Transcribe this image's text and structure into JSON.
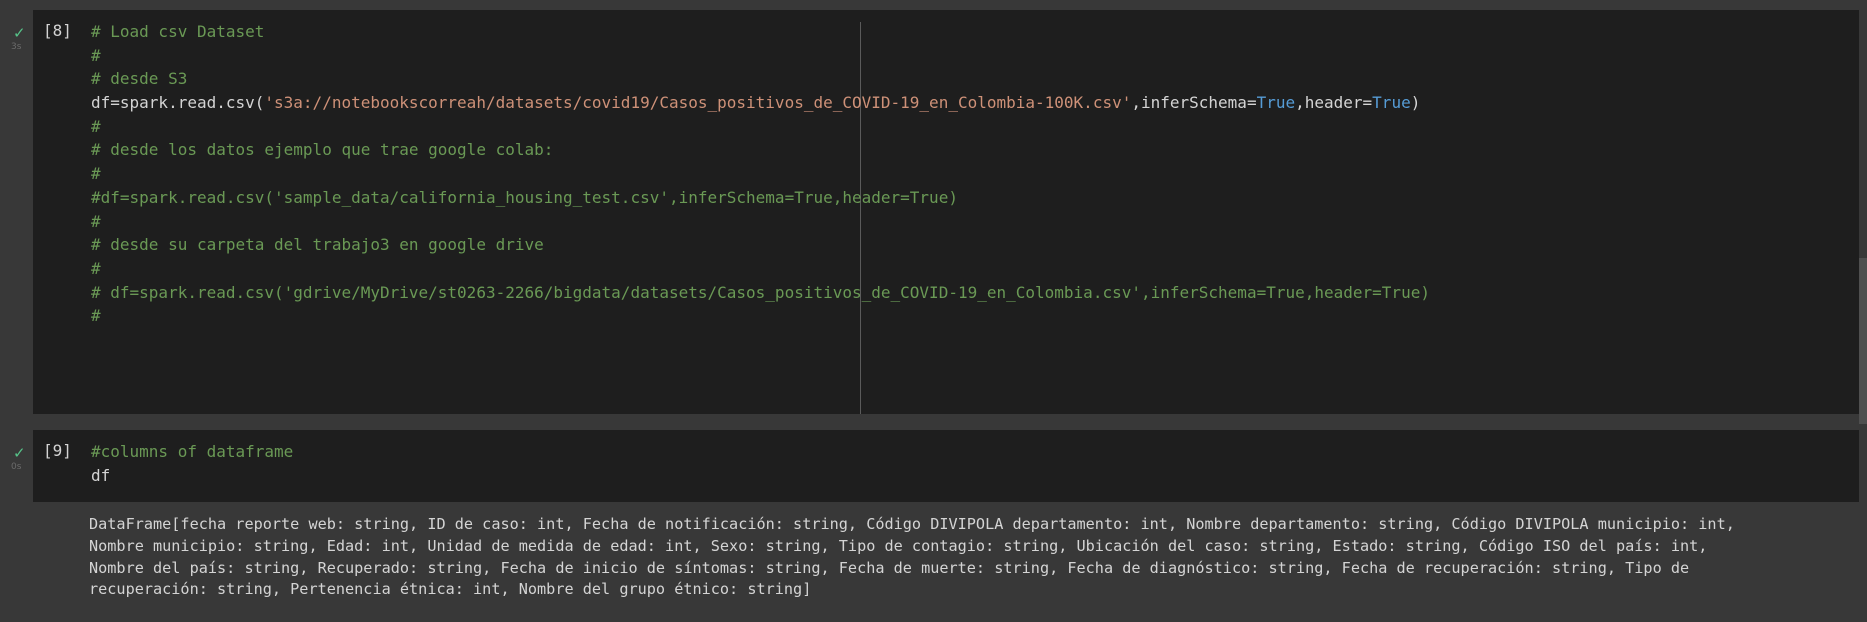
{
  "cells": [
    {
      "prompt": "[8]",
      "exec_time": "3s",
      "lines": [
        [
          {
            "t": "# Load csv Dataset",
            "c": "cm"
          }
        ],
        [
          {
            "t": "#",
            "c": "cm"
          }
        ],
        [
          {
            "t": "# desde S3",
            "c": "cm"
          }
        ],
        [
          {
            "t": "df=spark.read.csv(",
            "c": ""
          },
          {
            "t": "'s3a://notebookscorreah/datasets/covid19/Casos_positivos_de_COVID-19_en_Colombia-100K.csv'",
            "c": "str"
          },
          {
            "t": ",inferSchema=",
            "c": ""
          },
          {
            "t": "True",
            "c": "kw"
          },
          {
            "t": ",header=",
            "c": ""
          },
          {
            "t": "True",
            "c": "kw"
          },
          {
            "t": ")",
            "c": ""
          }
        ],
        [
          {
            "t": "#",
            "c": "cm"
          }
        ],
        [
          {
            "t": "# desde los datos ejemplo que trae google colab:",
            "c": "cm"
          }
        ],
        [
          {
            "t": "#",
            "c": "cm"
          }
        ],
        [
          {
            "t": "#df=spark.read.csv('sample_data/california_housing_test.csv',inferSchema=True,header=True)",
            "c": "cm"
          }
        ],
        [
          {
            "t": "#",
            "c": "cm"
          }
        ],
        [
          {
            "t": "# desde su carpeta del trabajo3 en google drive",
            "c": "cm"
          }
        ],
        [
          {
            "t": "#",
            "c": "cm"
          }
        ],
        [
          {
            "t": "# df=spark.read.csv('gdrive/MyDrive/st0263-2266/bigdata/datasets/Casos_positivos_de_COVID-19_en_Colombia.csv',inferSchema=True,header=True)",
            "c": "cm"
          }
        ],
        [
          {
            "t": "#",
            "c": "cm"
          }
        ]
      ]
    },
    {
      "prompt": "[9]",
      "exec_time": "0s",
      "lines": [
        [
          {
            "t": "#columns of dataframe",
            "c": "cm"
          }
        ],
        [
          {
            "t": "df",
            "c": ""
          }
        ]
      ],
      "output": [
        "DataFrame[fecha reporte web: string, ID de caso: int, Fecha de notificación: string, Código DIVIPOLA departamento: int, Nombre departamento: string, Código DIVIPOLA municipio: int,",
        "Nombre municipio: string, Edad: int, Unidad de medida de edad: int, Sexo: string, Tipo de contagio: string, Ubicación del caso: string, Estado: string, Código ISO del país: int,",
        "Nombre del país: string, Recuperado: string, Fecha de inicio de síntomas: string, Fecha de muerte: string, Fecha de diagnóstico: string, Fecha de recuperación: string, Tipo de",
        "recuperación: string, Pertenencia étnica: int, Nombre del grupo étnico: string]"
      ]
    }
  ],
  "icons": {
    "status": "check-icon"
  },
  "colors": {
    "comment": "#6a9955",
    "string": "#ce9178",
    "keyword": "#569cd6",
    "success": "#56c288"
  }
}
